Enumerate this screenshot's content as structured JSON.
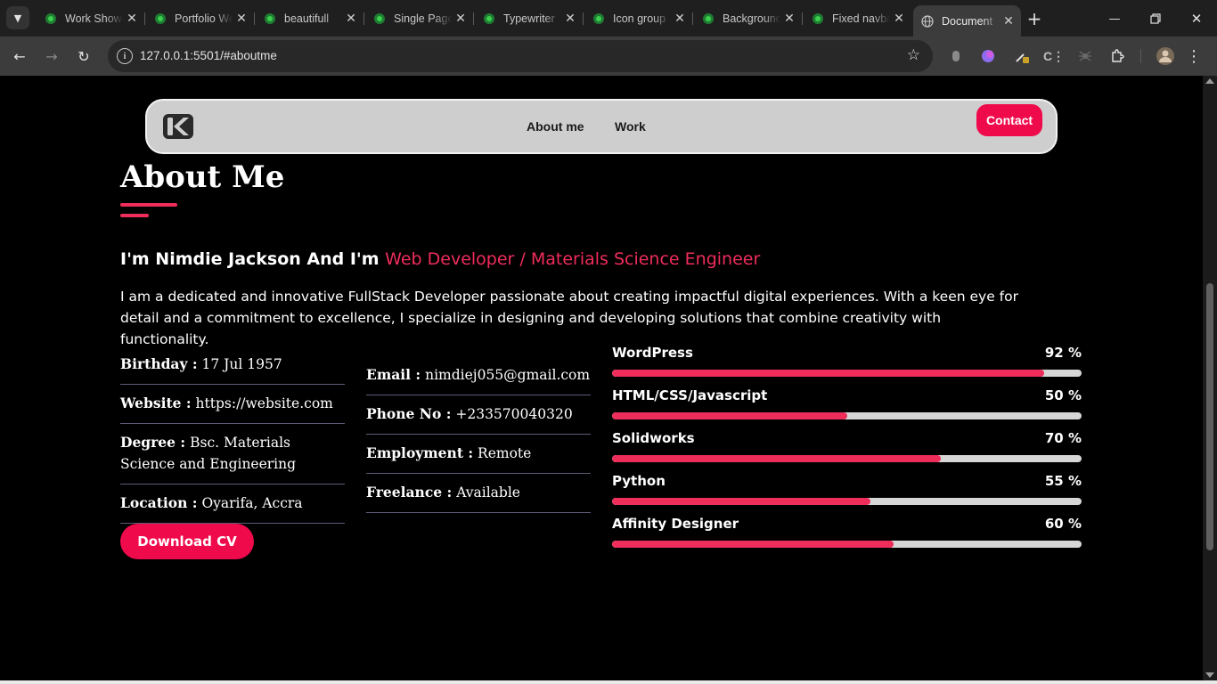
{
  "browser": {
    "tabs": [
      {
        "title": "Work Showcase",
        "active": false
      },
      {
        "title": "Portfolio Website",
        "active": false
      },
      {
        "title": "beautifull",
        "active": false
      },
      {
        "title": "Single Page",
        "active": false
      },
      {
        "title": "Typewriter",
        "active": false
      },
      {
        "title": "Icon group",
        "active": false
      },
      {
        "title": "Background",
        "active": false
      },
      {
        "title": "Fixed navbar",
        "active": false
      },
      {
        "title": "Document",
        "active": true
      }
    ],
    "url": "127.0.0.1:5501/#aboutme",
    "accent": "#ef2d5b"
  },
  "nav": {
    "links": [
      "About me",
      "Work"
    ],
    "contact_label": "Contact"
  },
  "about": {
    "title": "About Me",
    "intro_prefix": "I'm Nimdie Jackson And I'm ",
    "intro_role": "Web Developer / Materials Science Engineer",
    "bio": "I am a dedicated and innovative FullStack Developer passionate about creating impactful digital experiences. With a keen eye for detail and a commitment to excellence, I specialize in designing and developing solutions that combine creativity with functionality.",
    "info_left": [
      {
        "label": "Birthday :",
        "value": "17 Jul 1957"
      },
      {
        "label": "Website :",
        "value": "https://website.com"
      },
      {
        "label": "Degree :",
        "value": "Bsc. Materials Science and Engineering"
      },
      {
        "label": "Location :",
        "value": "Oyarifa, Accra"
      }
    ],
    "info_right": [
      {
        "label": "Email :",
        "value": "nimdiej055@gmail.com"
      },
      {
        "label": "Phone No :",
        "value": "+233570040320"
      },
      {
        "label": "Employment :",
        "value": "Remote"
      },
      {
        "label": "Freelance :",
        "value": "Available"
      }
    ],
    "cv_label": "Download CV",
    "skills": [
      {
        "name": "WordPress",
        "pct_label": "92 %",
        "value": 92
      },
      {
        "name": "HTML/CSS/Javascript",
        "pct_label": "50 %",
        "value": 50
      },
      {
        "name": "Solidworks",
        "pct_label": "70 %",
        "value": 70
      },
      {
        "name": "Python",
        "pct_label": "55 %",
        "value": 55
      },
      {
        "name": "Affinity Designer",
        "pct_label": "60 %",
        "value": 60
      }
    ]
  }
}
